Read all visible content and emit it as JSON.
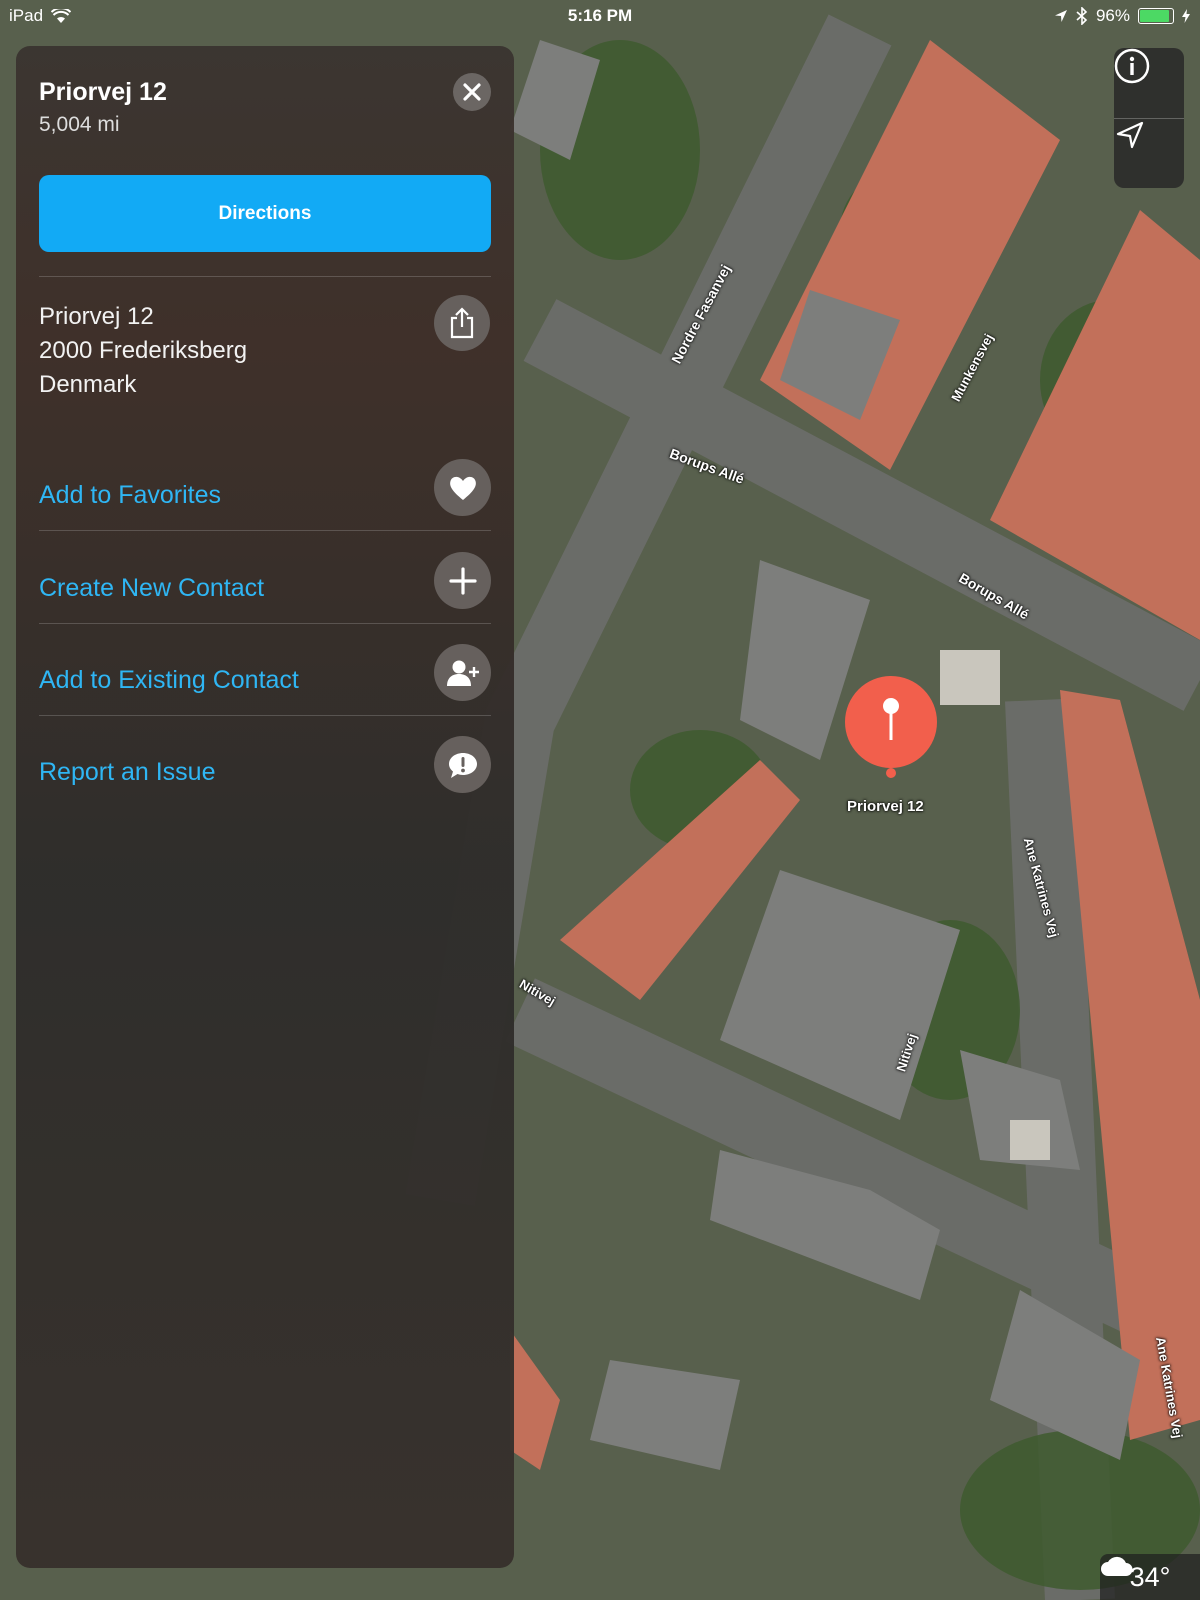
{
  "status_bar": {
    "device": "iPad",
    "time": "5:16 PM",
    "battery": "96%",
    "battery_level": 0.96
  },
  "place": {
    "title": "Priorvej 12",
    "distance": "5,004 mi",
    "directions_label": "Directions",
    "address_lines": [
      "Priorvej 12",
      "2000 Frederiksberg",
      "Denmark"
    ]
  },
  "actions": [
    {
      "label": "Add to Favorites",
      "icon": "heart-icon"
    },
    {
      "label": "Create New Contact",
      "icon": "plus-icon"
    },
    {
      "label": "Add to Existing Contact",
      "icon": "add-person-icon"
    },
    {
      "label": "Report an Issue",
      "icon": "exclamation-bubble-icon"
    }
  ],
  "map": {
    "pin_label": "Priorvej 12",
    "streets": [
      "Nordre Fasanvej",
      "Munkensvej",
      "Borups Allé",
      "Borups Allé",
      "Ane Katrines Vej",
      "Nitivej",
      "Nitivej",
      "Ane Katrines Vej"
    ],
    "weather": "34°",
    "accent_color": "#12aaf5",
    "pin_color": "#f25f4c"
  }
}
